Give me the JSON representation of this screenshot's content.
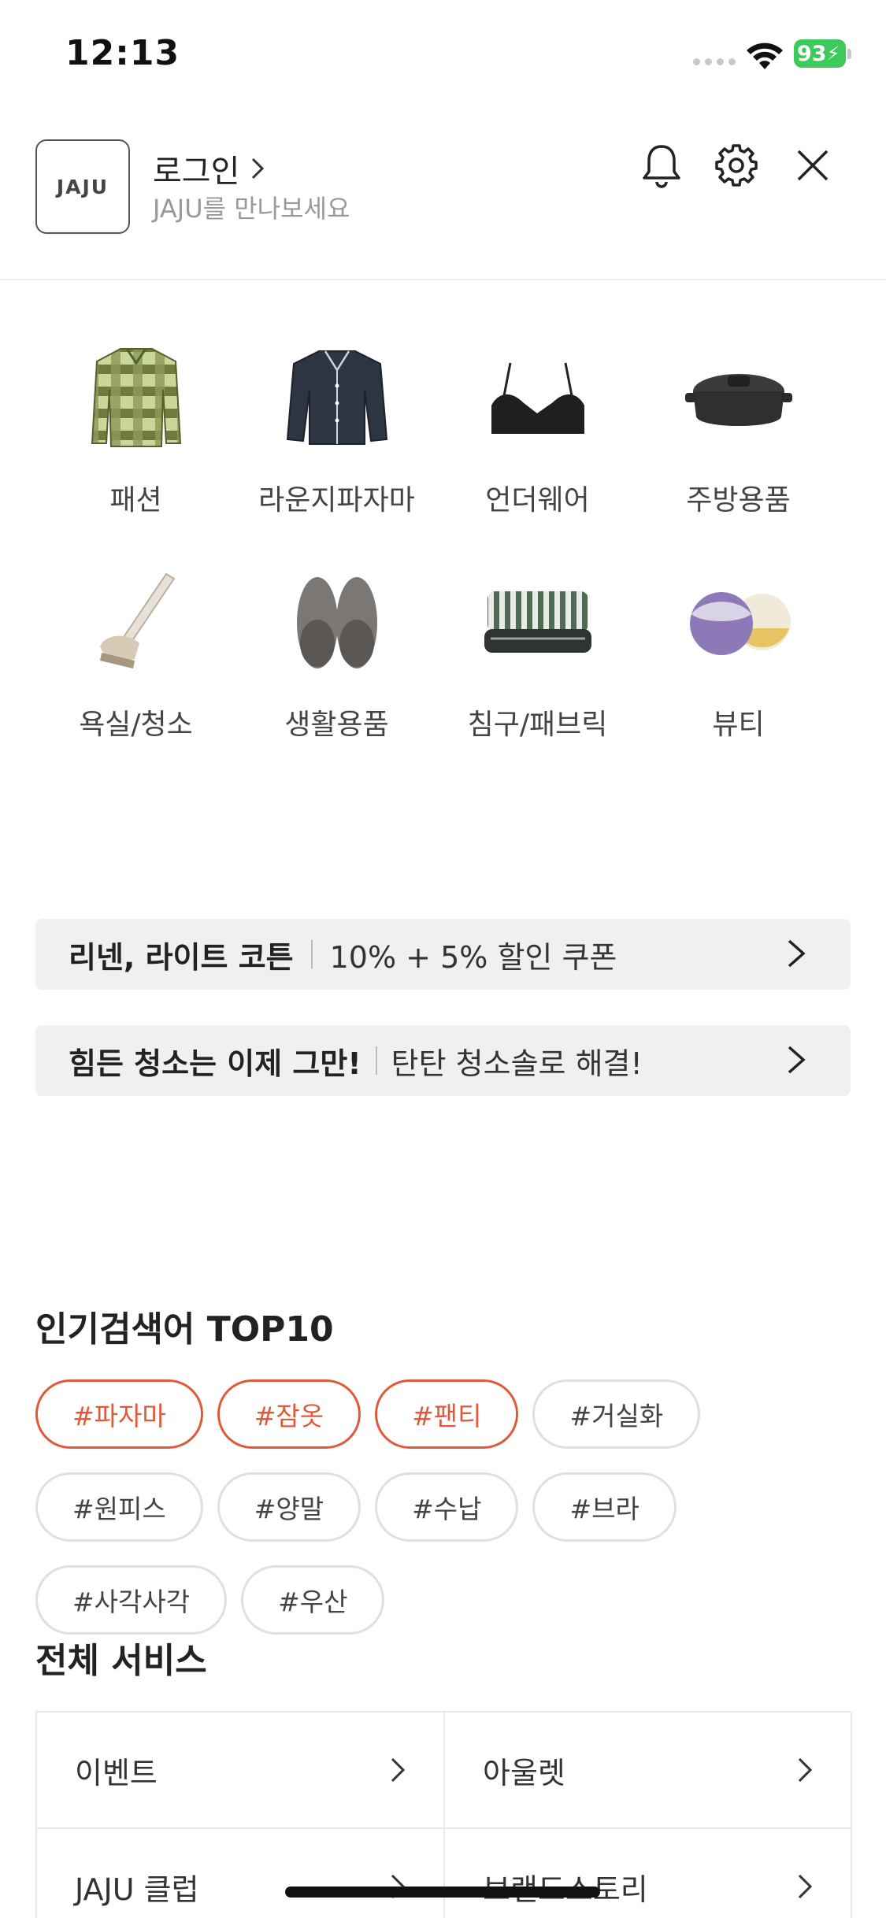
{
  "status_bar": {
    "time": "12:13",
    "battery": "93"
  },
  "header": {
    "logo_text": "JAJU",
    "login_label": "로그인",
    "login_subtitle": "JAJU를 만나보세요",
    "icons": [
      "bell-icon",
      "gear-icon",
      "close-icon"
    ]
  },
  "categories": [
    {
      "label": "패션",
      "icon": "plaid-shirt"
    },
    {
      "label": "라운지파자마",
      "icon": "pajama"
    },
    {
      "label": "언더웨어",
      "icon": "bra"
    },
    {
      "label": "주방용품",
      "icon": "pot"
    },
    {
      "label": "욕실/청소",
      "icon": "brush"
    },
    {
      "label": "생활용품",
      "icon": "slippers"
    },
    {
      "label": "침구/패브릭",
      "icon": "blanket"
    },
    {
      "label": "뷰티",
      "icon": "bath-bomb"
    }
  ],
  "banners": [
    {
      "bold": "리넨, 라이트 코튼",
      "light": "10% + 5% 할인 쿠폰"
    },
    {
      "bold": "힘든 청소는 이제 그만!",
      "light": "탄탄 청소솔로 해결!"
    }
  ],
  "popular": {
    "title": "인기검색어 TOP10",
    "tags": [
      "#파자마",
      "#잠옷",
      "#팬티",
      "#거실화",
      "#원피스",
      "#양말",
      "#수납",
      "#브라",
      "#사각사각",
      "#우산"
    ],
    "accent_color": "#e2593a"
  },
  "services": {
    "title": "전체 서비스",
    "items": [
      "이벤트",
      "아울렛",
      "JAJU 클럽",
      "브랜드스토리"
    ]
  }
}
